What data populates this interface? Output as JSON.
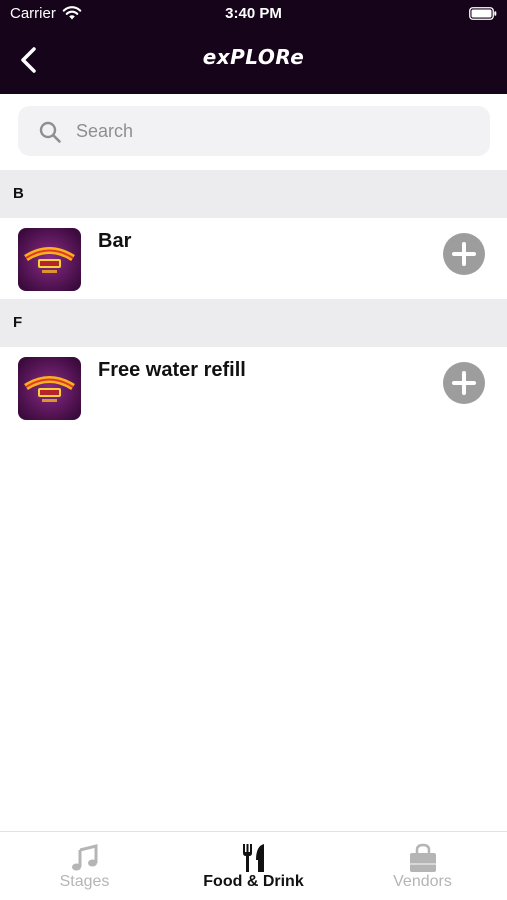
{
  "status_bar": {
    "carrier": "Carrier",
    "time": "3:40 PM"
  },
  "header": {
    "title": "exPLORe",
    "back_icon": "chevron-left-icon"
  },
  "search": {
    "placeholder": "Search",
    "value": ""
  },
  "sections": [
    {
      "letter": "B",
      "items": [
        {
          "name": "Bar",
          "thumbnail": "lights-festival-logo"
        }
      ]
    },
    {
      "letter": "F",
      "items": [
        {
          "name": "Free water refill",
          "thumbnail": "lights-festival-logo"
        }
      ]
    }
  ],
  "tabs": [
    {
      "label": "Stages",
      "icon": "music-note-icon",
      "active": false
    },
    {
      "label": "Food & Drink",
      "icon": "fork-knife-icon",
      "active": true
    },
    {
      "label": "Vendors",
      "icon": "shopping-bag-icon",
      "active": false
    }
  ],
  "colors": {
    "header_bg": "#16041a",
    "section_bg": "#ececef",
    "add_button": "#9d9d9d",
    "tab_inactive": "#b5b5b5"
  }
}
